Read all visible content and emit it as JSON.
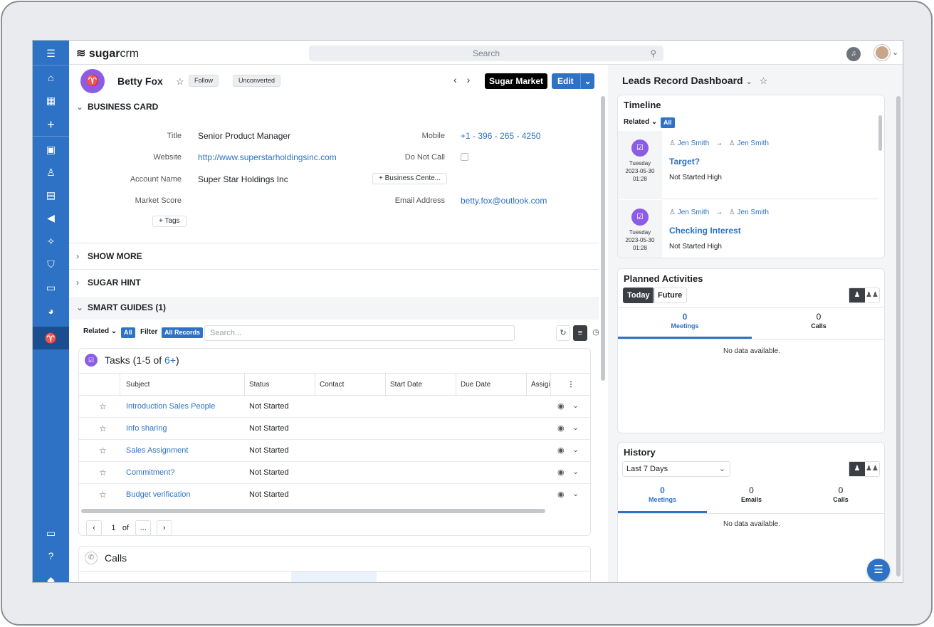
{
  "header": {
    "logo_bold": "sugar",
    "logo_rest": "crm",
    "search_placeholder": "Search"
  },
  "leftnav": {
    "icons": [
      "menu-icon",
      "home-icon",
      "calendar-icon",
      "plus-icon",
      "building-icon",
      "contact-icon",
      "clipboard-icon",
      "megaphone-icon",
      "leads-icon",
      "shield-icon",
      "document-icon",
      "chart-icon",
      "leads-active-icon"
    ],
    "bottom_icons": [
      "document-icon",
      "help-icon",
      "layers-icon"
    ]
  },
  "record": {
    "name": "Betty Fox",
    "follow_label": "Follow",
    "status_label": "Unconverted",
    "sugar_market_label": "Sugar Market",
    "edit_label": "Edit"
  },
  "business_card": {
    "title": "BUSINESS CARD",
    "fields": {
      "title_label": "Title",
      "title_value": "Senior Product Manager",
      "website_label": "Website",
      "website_value": "http://www.superstarholdingsinc.com",
      "account_label": "Account Name",
      "account_value": "Super Star Holdings Inc",
      "market_label": "Market Score",
      "mobile_label": "Mobile",
      "mobile_value": "+1 - 396 - 265 - 4250",
      "dnc_label": "Do Not Call",
      "email_label": "Email Address",
      "email_value": "betty.fox@outlook.com",
      "business_center_btn": "+ Business Cente...",
      "tags_btn": "+ Tags"
    }
  },
  "sections": {
    "show_more": "SHOW MORE",
    "sugar_hint": "SUGAR HINT",
    "smart_guides": "SMART GUIDES (1)"
  },
  "filter": {
    "related": "Related",
    "all": "All",
    "filter": "Filter",
    "all_records": "All Records",
    "search_placeholder": "Search..."
  },
  "tasks": {
    "title_prefix": "Tasks (1-5 of ",
    "title_count": "6+",
    "title_suffix": ")",
    "columns": [
      "Subject",
      "Status",
      "Contact",
      "Start Date",
      "Due Date",
      "Assigi"
    ],
    "rows": [
      {
        "subject": "Introduction Sales People",
        "status": "Not Started"
      },
      {
        "subject": "Info sharing",
        "status": "Not Started"
      },
      {
        "subject": "Sales Assignment",
        "status": "Not Started"
      },
      {
        "subject": "Commitment?",
        "status": "Not Started"
      },
      {
        "subject": "Budget verification",
        "status": "Not Started"
      }
    ],
    "pager": {
      "page": "1",
      "of": "of",
      "more": "..."
    }
  },
  "calls": {
    "title": "Calls"
  },
  "dashboard": {
    "title": "Leads Record Dashboard",
    "timeline": {
      "title": "Timeline",
      "related": "Related",
      "all": "All",
      "items": [
        {
          "from": "Jen Smith",
          "to": "Jen Smith",
          "day": "Tuesday",
          "date": "2023-05-30",
          "time": "01:28",
          "title": "Target?",
          "status": "Not Started",
          "priority": "High"
        },
        {
          "from": "Jen Smith",
          "to": "Jen Smith",
          "day": "Tuesday",
          "date": "2023-05-30",
          "time": "01:28",
          "title": "Checking Interest",
          "status": "Not Started",
          "priority": "High"
        }
      ]
    },
    "planned": {
      "title": "Planned Activities",
      "today": "Today",
      "future": "Future",
      "meetings_count": "0",
      "meetings_label": "Meetings",
      "calls_count": "0",
      "calls_label": "Calls",
      "no_data": "No data available."
    },
    "history": {
      "title": "History",
      "range": "Last 7 Days",
      "meetings_count": "0",
      "meetings_label": "Meetings",
      "emails_count": "0",
      "emails_label": "Emails",
      "calls_count": "0",
      "calls_label": "Calls",
      "no_data": "No data available."
    }
  },
  "colors": {
    "brand_blue": "#2d72c4",
    "nav_active": "#1a4e8f",
    "lead_purple": "#8d5ce6"
  }
}
